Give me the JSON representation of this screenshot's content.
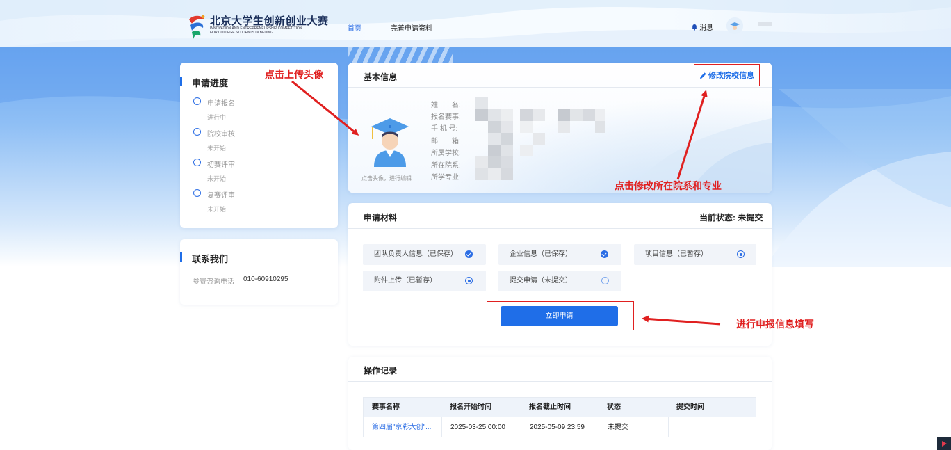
{
  "header": {
    "logo_title": "北京大学生创新创业大赛",
    "logo_sub_line1": "INNOVATION AND ENTREPRENEURSHIP COMPETITION",
    "logo_sub_line2": "FOR COLLEGE STUDENTS IN BEIJING",
    "nav": [
      {
        "label": "首页",
        "active": true
      },
      {
        "label": "完善申请资料",
        "active": false
      }
    ],
    "messages_label": "消息",
    "bell_icon": "bell-icon"
  },
  "progress": {
    "title": "申请进度",
    "steps": [
      {
        "name": "申请报名",
        "status": "进行中"
      },
      {
        "name": "院校审核",
        "status": "未开始"
      },
      {
        "name": "初赛评审",
        "status": "未开始"
      },
      {
        "name": "复赛评审",
        "status": "未开始"
      }
    ]
  },
  "contact": {
    "title": "联系我们",
    "phone_label": "参赛咨询电话",
    "phone": "010-60910295"
  },
  "basic_info": {
    "title": "基本信息",
    "edit_label": "修改院校信息",
    "edit_icon": "pencil-icon",
    "avatar_hint": "点击头像，进行编辑",
    "labels": [
      "姓　　名:",
      "报名赛事:",
      "手 机 号:",
      "邮　　箱:",
      "所属学校:",
      "所在院系:",
      "所学专业:"
    ]
  },
  "materials": {
    "title": "申请材料",
    "status_label": "当前状态:",
    "status_value": "未提交",
    "items": [
      {
        "label": "团队负责人信息（已保存）",
        "state": "done"
      },
      {
        "label": "企业信息（已保存）",
        "state": "done"
      },
      {
        "label": "项目信息（已暂存）",
        "state": "partial"
      },
      {
        "label": "附件上传（已暂存）",
        "state": "partial"
      },
      {
        "label": "提交申请（未提交）",
        "state": "none"
      }
    ],
    "apply_button": "立即申请"
  },
  "log": {
    "title": "操作记录",
    "columns": [
      "赛事名称",
      "报名开始时间",
      "报名截止时间",
      "状态",
      "提交时间"
    ],
    "rows": [
      [
        "第四届\"京彩大创\"...",
        "2025-03-25 00:00",
        "2025-05-09 23:59",
        "未提交",
        ""
      ]
    ]
  },
  "annotations": {
    "avatar": "点击上传头像",
    "edit": "点击修改所在院系和专业",
    "apply": "进行申报信息填写"
  },
  "colors": {
    "brand_blue": "#1f6ee8",
    "annotation_red": "#e02020"
  }
}
